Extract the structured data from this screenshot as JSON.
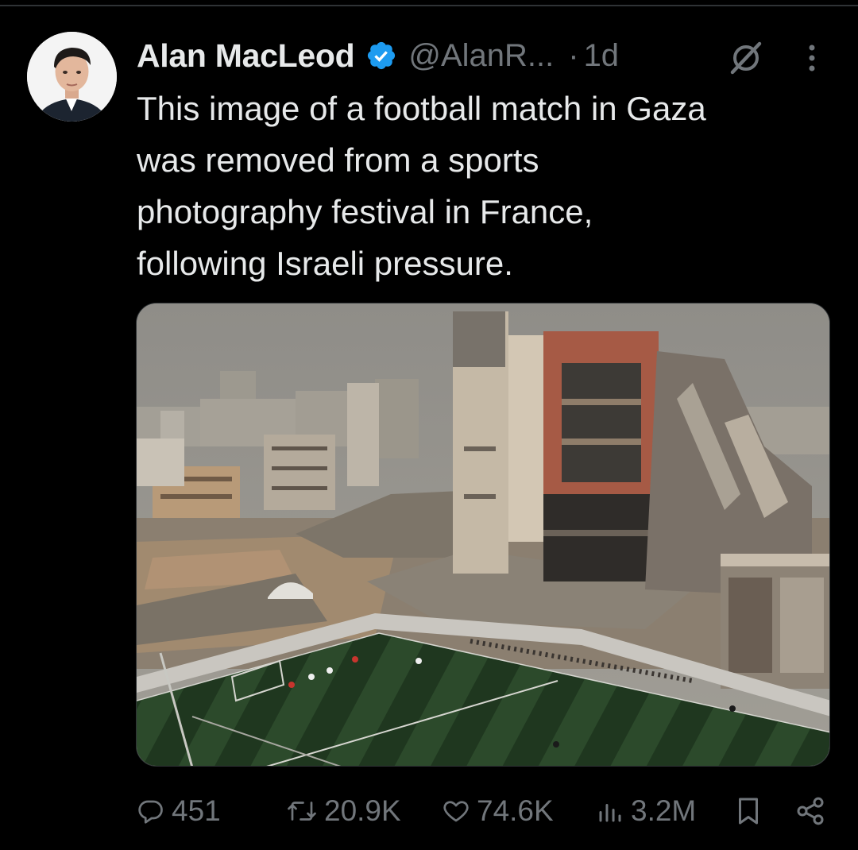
{
  "tweet": {
    "author": {
      "display_name": "Alan MacLeod",
      "handle": "@AlanR...",
      "verified": true,
      "avatar_icon": "profile-photo"
    },
    "separator": "·",
    "time": "1d",
    "text_lines": [
      "This image of a football match in Gaza",
      "was removed from a sports",
      "photography festival in France,",
      "following Israeli pressure."
    ],
    "media": {
      "type": "photo",
      "icon": "photo-football-match-amid-ruins"
    },
    "actions": {
      "replies": "451",
      "reposts": "20.9K",
      "likes": "74.6K",
      "views": "3.2M"
    }
  },
  "icons": {
    "grok": "grok-icon",
    "more": "more-icon",
    "reply": "reply-icon",
    "repost": "repost-icon",
    "like": "like-icon",
    "views": "views-icon",
    "bookmark": "bookmark-icon",
    "share": "share-icon"
  },
  "colors": {
    "background": "#000000",
    "text": "#e7e9ea",
    "secondary": "#71767b",
    "verified": "#1d9bf0"
  }
}
